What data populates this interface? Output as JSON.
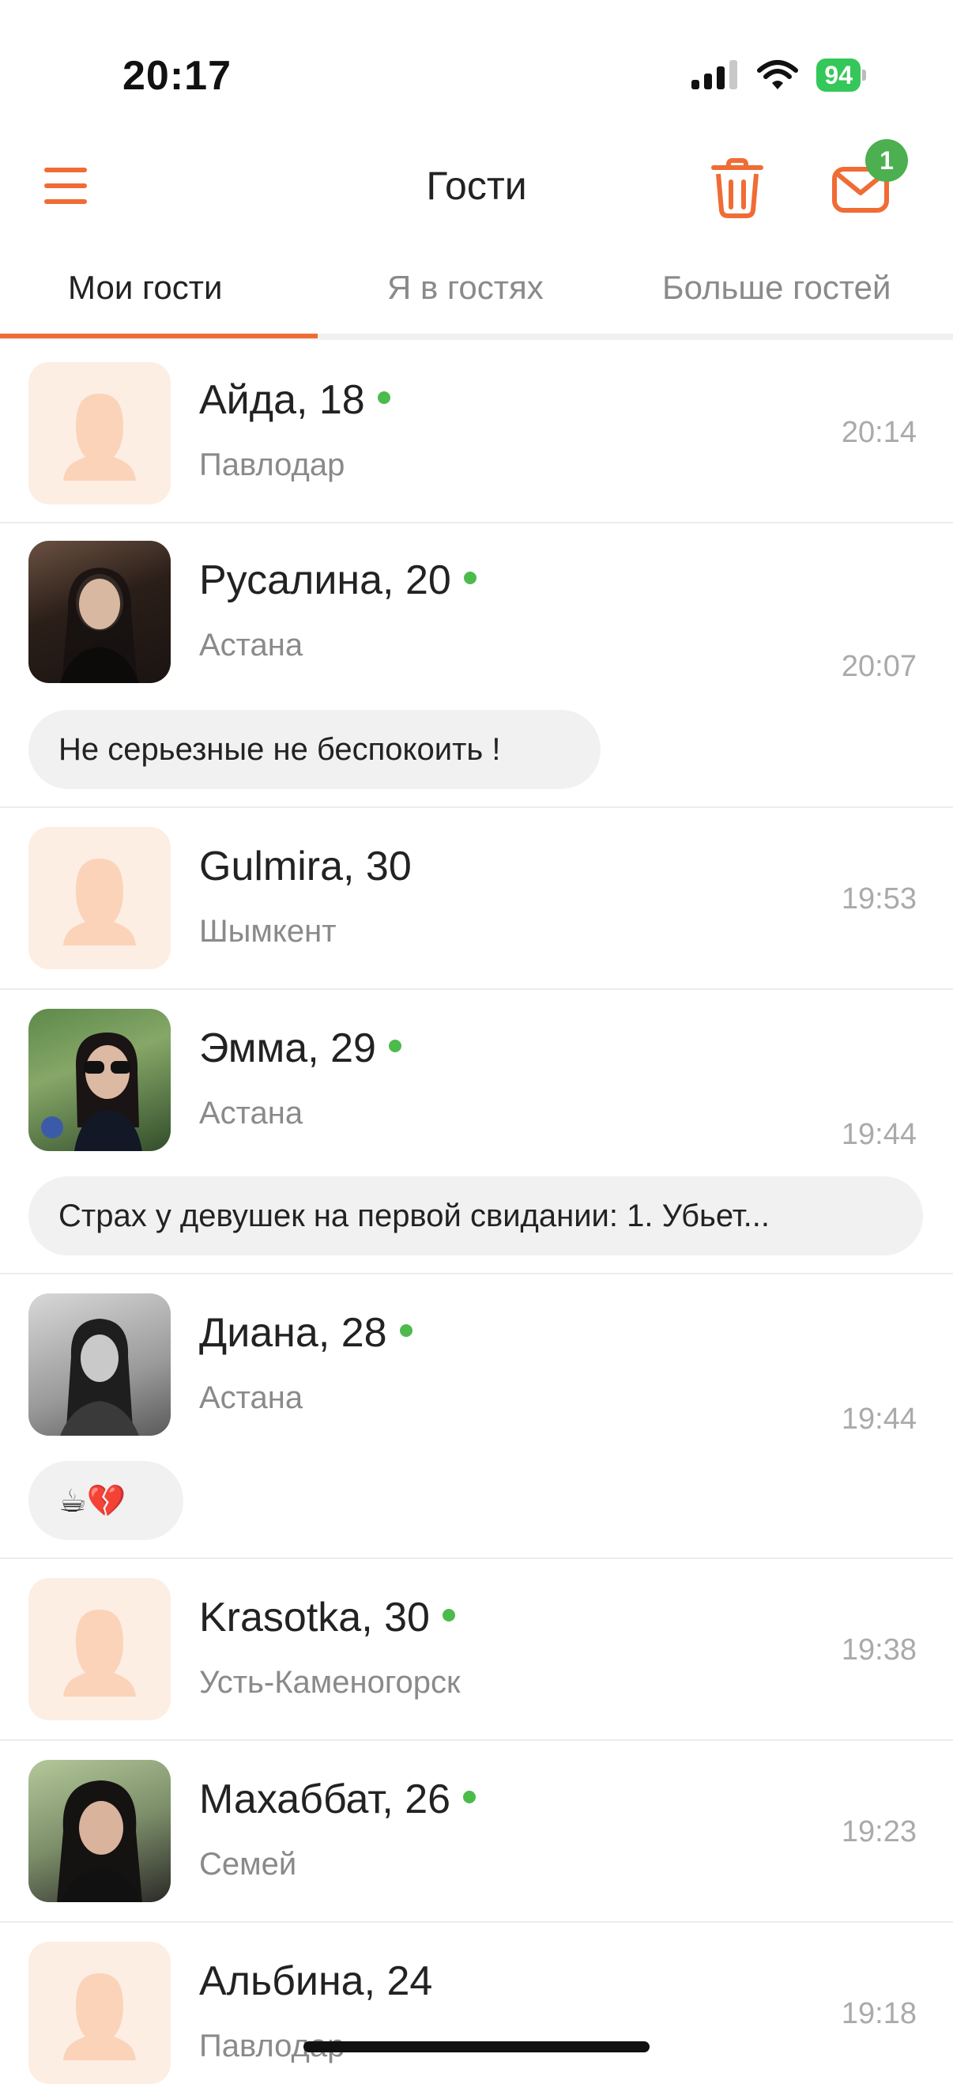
{
  "status_bar": {
    "time": "20:17",
    "battery": "94"
  },
  "header": {
    "title": "Гости",
    "mail_badge": "1"
  },
  "tabs": [
    {
      "label": "Мои гости",
      "active": true
    },
    {
      "label": "Я в гостях",
      "active": false
    },
    {
      "label": "Больше гостей",
      "active": false
    }
  ],
  "guests": [
    {
      "name": "Айда, 18",
      "city": "Павлодар",
      "time": "20:14",
      "online": true
    },
    {
      "name": "Русалина, 20",
      "city": "Астана",
      "time": "20:07",
      "online": true,
      "status": "Не серьезные не беспокоить !"
    },
    {
      "name": "Gulmira, 30",
      "city": "Шымкент",
      "time": "19:53",
      "online": false
    },
    {
      "name": "Эмма, 29",
      "city": "Астана",
      "time": "19:44",
      "online": true,
      "status": "Страх у девушек на первой свидании: 1. Убьет..."
    },
    {
      "name": "Диана, 28",
      "city": "Астана",
      "time": "19:44",
      "online": true,
      "status": "☕💔"
    },
    {
      "name": "Krasotka, 30",
      "city": "Усть-Каменогорск",
      "time": "19:38",
      "online": true
    },
    {
      "name": "Махаббат, 26",
      "city": "Семей",
      "time": "19:23",
      "online": true
    },
    {
      "name": "Альбина, 24",
      "city": "Павлодар",
      "time": "19:18",
      "online": false
    }
  ],
  "colors": {
    "accent": "#f06c35",
    "online": "#4cbb4c",
    "placeholder_bg": "#fdeee4",
    "placeholder_icon": "#fbd3b9"
  },
  "icons": [
    "menu-icon",
    "trash-icon",
    "mail-icon",
    "female-silhouette-icon",
    "signal-icon",
    "wifi-icon",
    "battery-icon"
  ]
}
